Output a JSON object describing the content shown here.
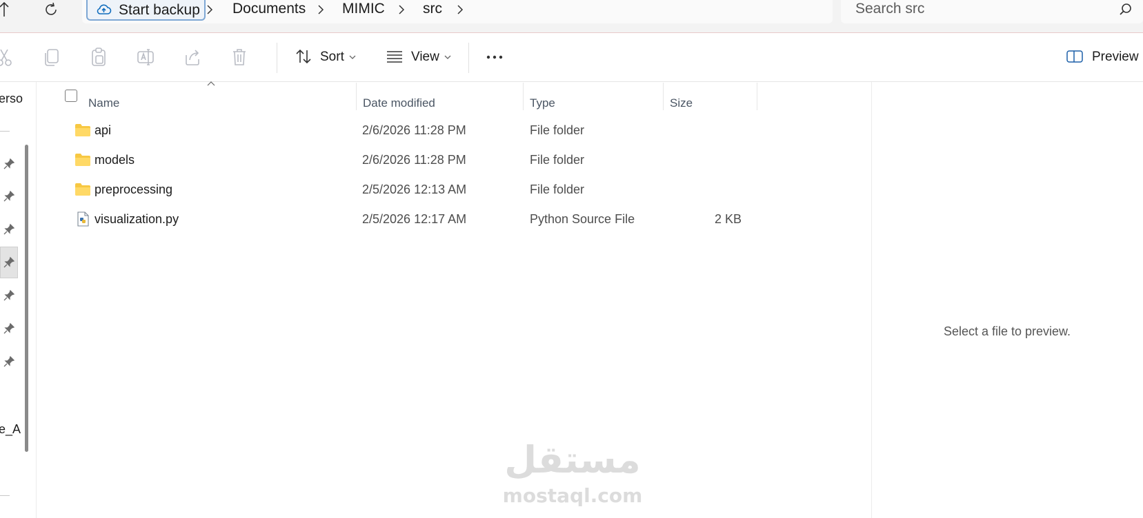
{
  "address_bar": {
    "backup_label": "Start backup",
    "breadcrumb": [
      "Documents",
      "MIMIC",
      "src"
    ],
    "search_placeholder": "Search src"
  },
  "toolbar": {
    "buttons": [
      "cut",
      "copy",
      "paste",
      "rename",
      "share",
      "delete"
    ],
    "sort_label": "Sort",
    "view_label": "View",
    "preview_label": "Preview"
  },
  "nav_pane": {
    "fragment_top": "erso",
    "fragment_bottom": "e_A"
  },
  "file_list": {
    "columns": [
      "Name",
      "Date modified",
      "Type",
      "Size"
    ],
    "rows": [
      {
        "name": "api",
        "date": "2/6/2026 11:28 PM",
        "type": "File folder",
        "size": "",
        "icon": "folder-icon"
      },
      {
        "name": "models",
        "date": "2/6/2026 11:28 PM",
        "type": "File folder",
        "size": "",
        "icon": "folder-icon"
      },
      {
        "name": "preprocessing",
        "date": "2/5/2026 12:13 AM",
        "type": "File folder",
        "size": "",
        "icon": "folder-icon"
      },
      {
        "name": "visualization.py",
        "date": "2/5/2026 12:17 AM",
        "type": "Python Source File",
        "size": "2 KB",
        "icon": "python-file-icon"
      }
    ]
  },
  "preview_pane": {
    "message": "Select a file to preview."
  },
  "watermark": {
    "arabic": "مستقل",
    "latin": "mostaql.com"
  },
  "colors": {
    "accent": "#0f6cbd",
    "folder": "#f7c843",
    "header_text": "#4a5563"
  }
}
